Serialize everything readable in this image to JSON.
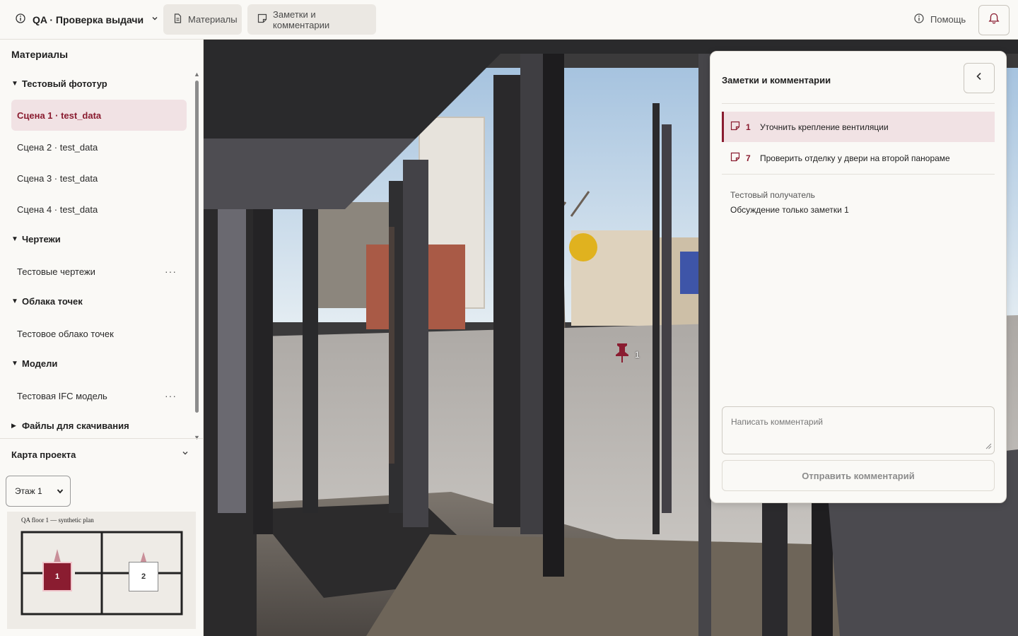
{
  "topbar": {
    "project_title": "QA · Проверка выдачи",
    "materials_label": "Материалы",
    "notes_label": "Заметки и комментарии",
    "help_label": "Помощь"
  },
  "sidebar": {
    "heading": "Материалы",
    "groups": [
      {
        "label": "Тестовый фототур",
        "expanded": true,
        "items": [
          {
            "label": "Сцена 1 · test_data",
            "active": true
          },
          {
            "label": "Сцена 2 · test_data"
          },
          {
            "label": "Сцена 3 · test_data"
          },
          {
            "label": "Сцена 4 · test_data"
          }
        ]
      },
      {
        "label": "Чертежи",
        "expanded": true,
        "items": [
          {
            "label": "Тестовые чертежи",
            "more": "···"
          }
        ]
      },
      {
        "label": "Облака точек",
        "expanded": true,
        "items": [
          {
            "label": "Тестовое облако точек"
          }
        ]
      },
      {
        "label": "Модели",
        "expanded": true,
        "items": [
          {
            "label": "Тестовая IFC модель",
            "more": "···"
          }
        ]
      },
      {
        "label": "Файлы для скачивания",
        "expanded": false
      }
    ],
    "map": {
      "title": "Карта проекта",
      "floor_select": "Этаж 1",
      "plan_title": "QA floor 1 — synthetic plan",
      "pins": [
        {
          "label": "1",
          "active": true
        },
        {
          "label": "2",
          "active": false
        }
      ]
    }
  },
  "viewer": {
    "marker_label": "1"
  },
  "notes_panel": {
    "title": "Заметки и комментарии",
    "notes": [
      {
        "id": "1",
        "text": "Уточнить крепление вентиляции",
        "active": true
      },
      {
        "id": "7",
        "text": "Проверить отделку у двери на второй панораме",
        "active": false
      }
    ],
    "recipient": "Тестовый получатель",
    "discussion": "Обсуждение только заметки 1",
    "comment_placeholder": "Написать комментарий",
    "send_label": "Отправить комментарий"
  },
  "colors": {
    "accent": "#8a1c30",
    "accent_bg": "#f1e2e4",
    "surface": "#faf9f6"
  }
}
